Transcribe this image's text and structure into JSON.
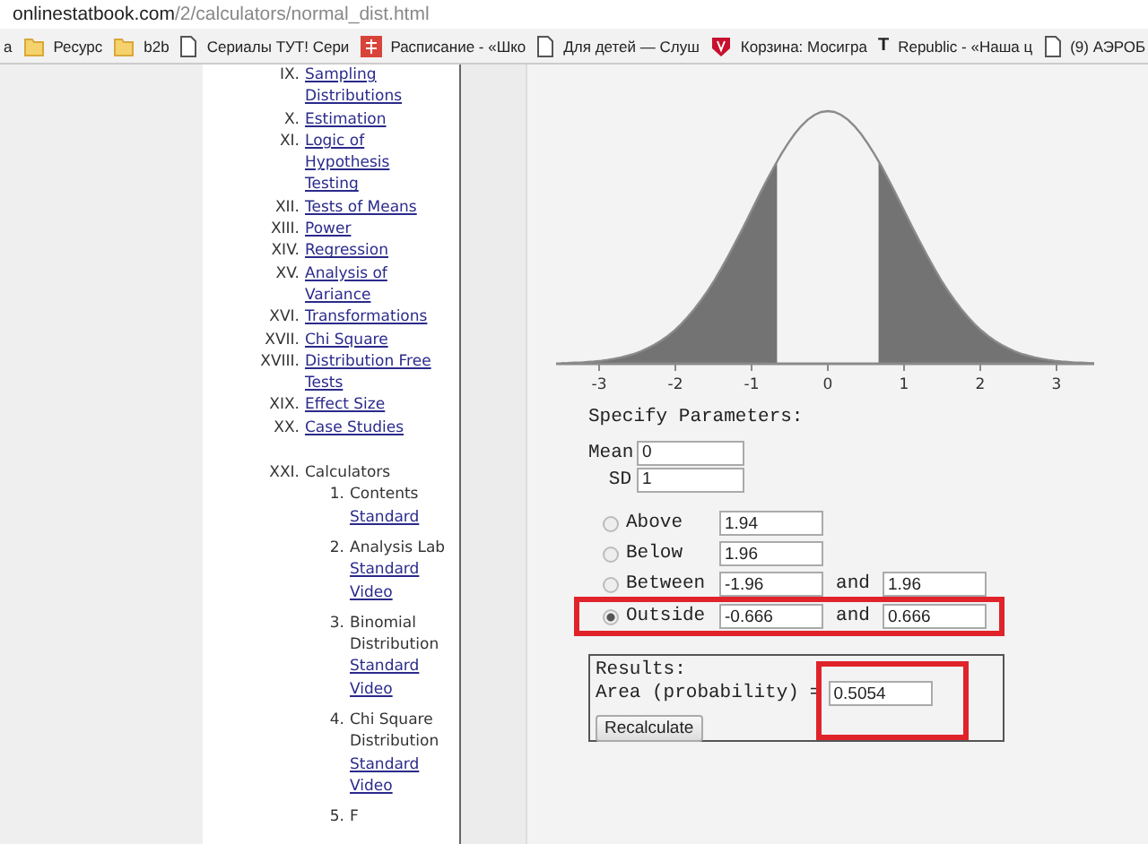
{
  "browser": {
    "address": {
      "domain": "onlinestatbook.com",
      "path": "/2/calculators/normal_dist.html"
    },
    "bookmarks": [
      {
        "kind": "none",
        "label": "а"
      },
      {
        "kind": "folder",
        "label": "Ресурс"
      },
      {
        "kind": "folder",
        "label": "b2b"
      },
      {
        "kind": "page",
        "label": "Сериалы ТУТ! Сери"
      },
      {
        "kind": "red",
        "label": "Расписание - «Шко"
      },
      {
        "kind": "page",
        "label": "Для детей — Слуш"
      },
      {
        "kind": "shield",
        "label": "Корзина: Мосигра"
      },
      {
        "kind": "letter",
        "label": "Republic - «Наша ц",
        "glyph": "T"
      },
      {
        "kind": "page",
        "label": "(9) АЭРОБ"
      }
    ]
  },
  "nav": {
    "items": [
      {
        "numeral": "IX.",
        "label": "Sampling Distributions"
      },
      {
        "numeral": "X.",
        "label": "Estimation"
      },
      {
        "numeral": "XI.",
        "label": "Logic of Hypothesis Testing"
      },
      {
        "numeral": "XII.",
        "label": "Tests of Means"
      },
      {
        "numeral": "XIII.",
        "label": "Power"
      },
      {
        "numeral": "XIV.",
        "label": "Regression"
      },
      {
        "numeral": "XV.",
        "label": "Analysis of Variance"
      },
      {
        "numeral": "XVI.",
        "label": "Transformations"
      },
      {
        "numeral": "XVII.",
        "label": "Chi Square"
      },
      {
        "numeral": "XVIII.",
        "label": "Distribution Free Tests"
      },
      {
        "numeral": "XIX.",
        "label": "Effect Size"
      },
      {
        "numeral": "XX.",
        "label": "Case Studies"
      }
    ],
    "calculators": {
      "numeral": "XXI.",
      "label": "Calculators",
      "children": [
        {
          "number": "1.",
          "label": "Contents",
          "links": [
            "Standard"
          ]
        },
        {
          "number": "2.",
          "label": "Analysis Lab",
          "links": [
            "Standard",
            "Video"
          ]
        },
        {
          "number": "3.",
          "label": "Binomial Distribution",
          "links": [
            "Standard",
            "Video"
          ]
        },
        {
          "number": "4.",
          "label": "Chi Square Distribution",
          "links": [
            "Standard",
            "Video"
          ]
        },
        {
          "number": "5.",
          "label": "F"
        }
      ]
    }
  },
  "chart": {
    "tick_labels": [
      "-3",
      "-2",
      "-1",
      "0",
      "1",
      "2",
      "3"
    ]
  },
  "form": {
    "title": "Specify Parameters:",
    "mean": {
      "label": "Mean",
      "value": "0"
    },
    "sd": {
      "label": "SD",
      "value": "1"
    },
    "options": [
      {
        "kind": "above",
        "label": "Above",
        "value": "1.94",
        "selected": false,
        "highlighted": false
      },
      {
        "kind": "below",
        "label": "Below",
        "value": "1.96",
        "selected": false,
        "highlighted": false
      },
      {
        "kind": "between",
        "label": "Between",
        "value": "-1.96",
        "and_label": "and",
        "value2": "1.96",
        "selected": false,
        "highlighted": false
      },
      {
        "kind": "outside",
        "label": "Outside",
        "value": "-0.666",
        "and_label": "and",
        "value2": "0.666",
        "selected": true,
        "highlighted": true
      }
    ],
    "results": {
      "title": "Results:",
      "label": "Area (probability)",
      "equals": "=",
      "value": "0.5054",
      "highlighted": true,
      "button": "Recalculate"
    }
  }
}
